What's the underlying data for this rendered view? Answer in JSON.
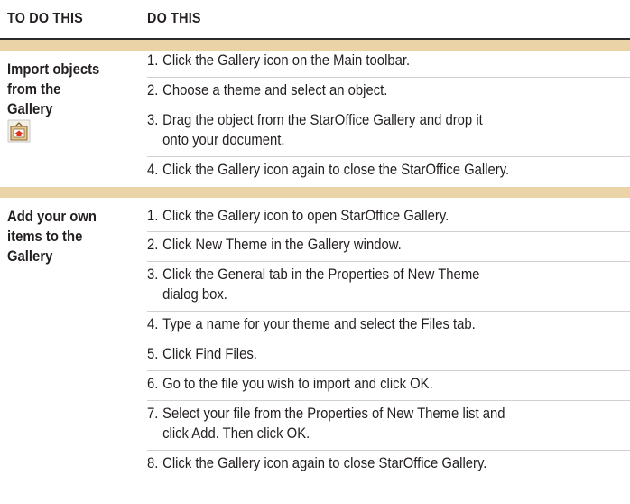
{
  "header": {
    "col1": "TO DO THIS",
    "col2": "DO THIS"
  },
  "rows": [
    {
      "task": [
        "Import objects",
        "from the",
        "Gallery"
      ],
      "icon": "gallery-icon",
      "steps": [
        {
          "num": "1.",
          "lines": [
            "Click the Gallery icon on the Main toolbar."
          ]
        },
        {
          "num": "2.",
          "lines": [
            "Choose a theme and select an object."
          ]
        },
        {
          "num": "3.",
          "lines": [
            "Drag the object from the StarOffice Gallery and drop it",
            "onto your document."
          ]
        },
        {
          "num": "4.",
          "lines": [
            "Click the Gallery icon again to close the StarOffice Gallery."
          ]
        }
      ]
    },
    {
      "task": [
        "Add your own",
        "items to the",
        "Gallery"
      ],
      "steps": [
        {
          "num": "1.",
          "lines": [
            "Click the Gallery icon to open StarOffice Gallery."
          ]
        },
        {
          "num": "2.",
          "lines": [
            "Click New Theme in the Gallery window."
          ]
        },
        {
          "num": "3.",
          "lines": [
            "Click the General tab in the Properties of New Theme",
            "dialog box."
          ]
        },
        {
          "num": "4.",
          "lines": [
            "Type a name for your theme and select the Files tab."
          ]
        },
        {
          "num": "5.",
          "lines": [
            "Click Find Files."
          ]
        },
        {
          "num": "6.",
          "lines": [
            "Go to the file you wish to import and click OK."
          ]
        },
        {
          "num": "7.",
          "lines": [
            "Select your file from the Properties of New Theme list and",
            "click Add. Then click OK."
          ]
        },
        {
          "num": "8.",
          "lines": [
            "Click the Gallery icon again to close StarOffice Gallery."
          ]
        }
      ]
    }
  ],
  "colors": {
    "band": "#ebd3a8",
    "text": "#231f20"
  }
}
